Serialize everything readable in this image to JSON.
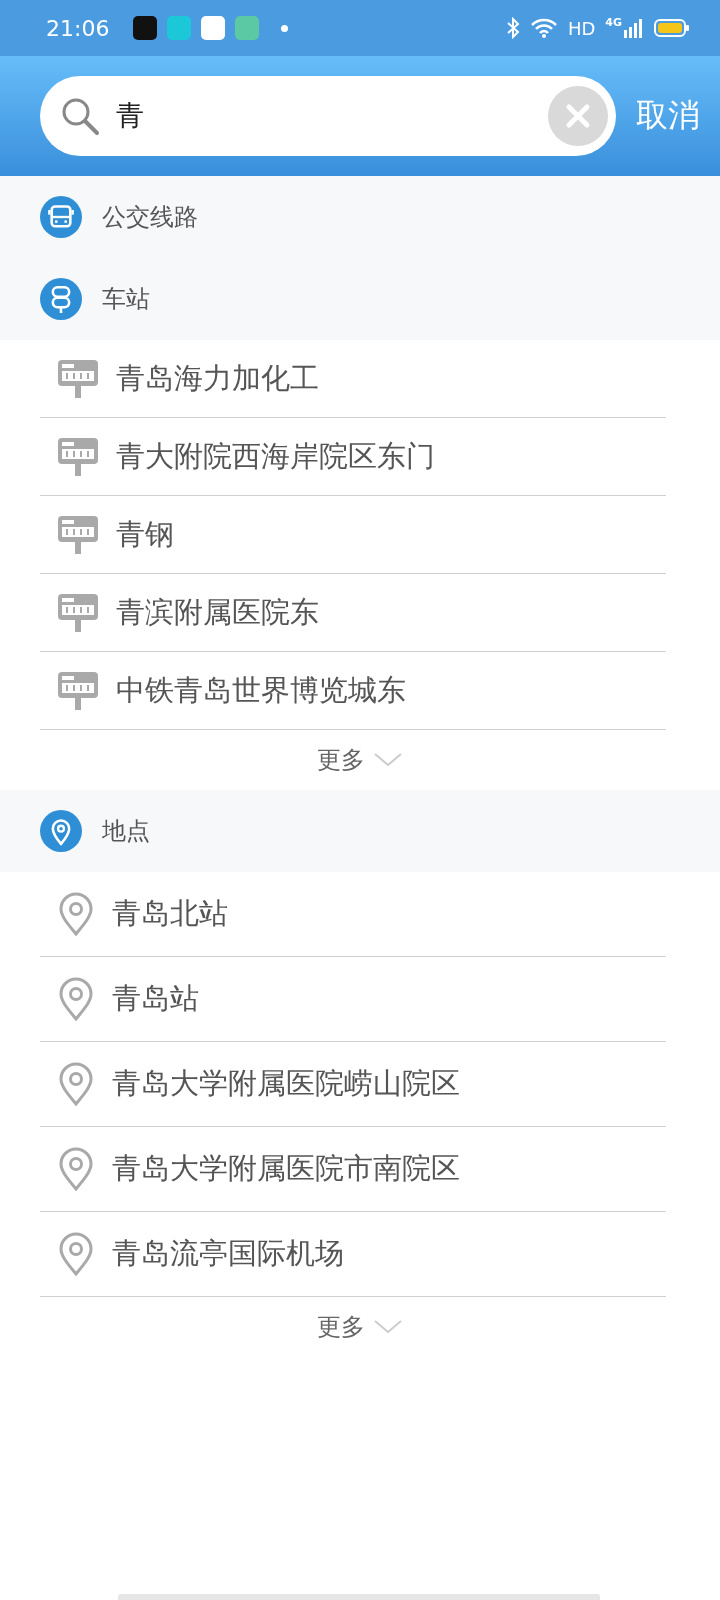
{
  "status_bar": {
    "time": "21:06",
    "hd": "HD",
    "network": "4G"
  },
  "search": {
    "value": "青",
    "cancel": "取消"
  },
  "sections": [
    {
      "kind": "bus",
      "title": "公交线路"
    },
    {
      "kind": "station",
      "title": "车站",
      "results": [
        "青岛海力加化工",
        "青大附院西海岸院区东门",
        "青钢",
        "青滨附属医院东",
        "中铁青岛世界博览城东"
      ],
      "more": "更多"
    },
    {
      "kind": "place",
      "title": "地点",
      "results": [
        "青岛北站",
        "青岛站",
        "青岛大学附属医院崂山院区",
        "青岛大学附属医院市南院区",
        "青岛流亭国际机场"
      ],
      "more": "更多"
    }
  ]
}
